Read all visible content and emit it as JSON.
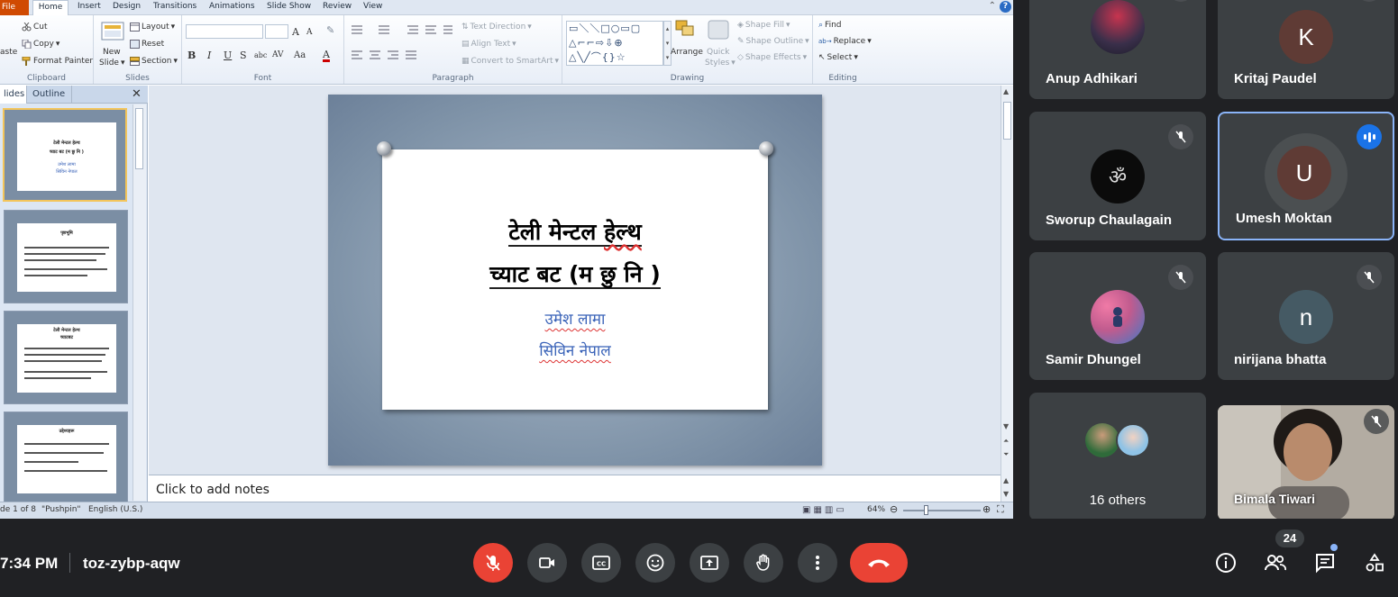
{
  "ribbon": {
    "tabs": [
      "File",
      "Home",
      "Insert",
      "Design",
      "Transitions",
      "Animations",
      "Slide Show",
      "Review",
      "View"
    ],
    "clipboard": {
      "paste": "aste",
      "cut": "Cut",
      "copy": "Copy",
      "format_painter": "Format Painter",
      "label": "Clipboard"
    },
    "slides": {
      "new_slide_1": "New",
      "new_slide_2": "Slide",
      "layout": "Layout",
      "reset": "Reset",
      "section": "Section",
      "label": "Slides"
    },
    "font": {
      "bold": "B",
      "italic": "I",
      "underline": "U",
      "strike": "S",
      "shadow": "abc",
      "spacing": "AV",
      "case": "Aa",
      "color": "A",
      "grow": "A",
      "shrink": "A",
      "label": "Font"
    },
    "paragraph": {
      "text_direction": "Text Direction",
      "align_text": "Align Text",
      "convert_smartart": "Convert to SmartArt",
      "label": "Paragraph"
    },
    "drawing": {
      "arrange": "Arrange",
      "quick_styles_1": "Quick",
      "quick_styles_2": "Styles",
      "shape_fill": "Shape Fill",
      "shape_outline": "Shape Outline",
      "shape_effects": "Shape Effects",
      "label": "Drawing"
    },
    "editing": {
      "find": "Find",
      "replace": "Replace",
      "select": "Select",
      "label": "Editing"
    }
  },
  "pane": {
    "tab_slides": "lides",
    "tab_outline": "Outline",
    "close": "✕"
  },
  "slide": {
    "title_line1_a": "टेली मेन्टल",
    "title_line1_b": "हेल्थ",
    "title_line2": "च्याट बट (म छु नि )",
    "author1": "उमेश लामा",
    "author2": "सिविन नेपाल"
  },
  "thumbnails": [
    {
      "title1": "टेली मेन्टल हेल्थ",
      "title2": "च्याट बट (म छु नि )",
      "sub1": "उमेश लामा",
      "sub2": "सिविन नेपाल"
    },
    {
      "title1": "पृष्ठभूमि"
    },
    {
      "title1": "टेली मेन्टल हेल्थ",
      "title2": "च्याटबट"
    },
    {
      "title1": "उद्देश्यहरू"
    }
  ],
  "notes": {
    "placeholder": "Click to add notes"
  },
  "statusbar": {
    "slide_of": "de 1 of 8",
    "theme": "\"Pushpin\"",
    "language": "English (U.S.)",
    "zoom": "64%"
  },
  "participants": [
    {
      "name": "Anup Adhikari"
    },
    {
      "name": "Kritaj Paudel",
      "initial": "K"
    },
    {
      "name": "Sworup Chaulagain"
    },
    {
      "name": "Umesh Moktan",
      "initial": "U"
    },
    {
      "name": "Samir Dhungel"
    },
    {
      "name": "nirijana bhatta",
      "initial": "n"
    },
    {
      "name": "16 others"
    },
    {
      "name": "Bimala Tiwari"
    }
  ],
  "meet": {
    "time": "7:34 PM",
    "code": "toz-zybp-aqw",
    "people_count": "24"
  },
  "colors": {
    "meet_bg": "#202124",
    "tile_bg": "#3c4043",
    "end_call": "#ea4335",
    "active_speaker": "#8ab4f8"
  }
}
